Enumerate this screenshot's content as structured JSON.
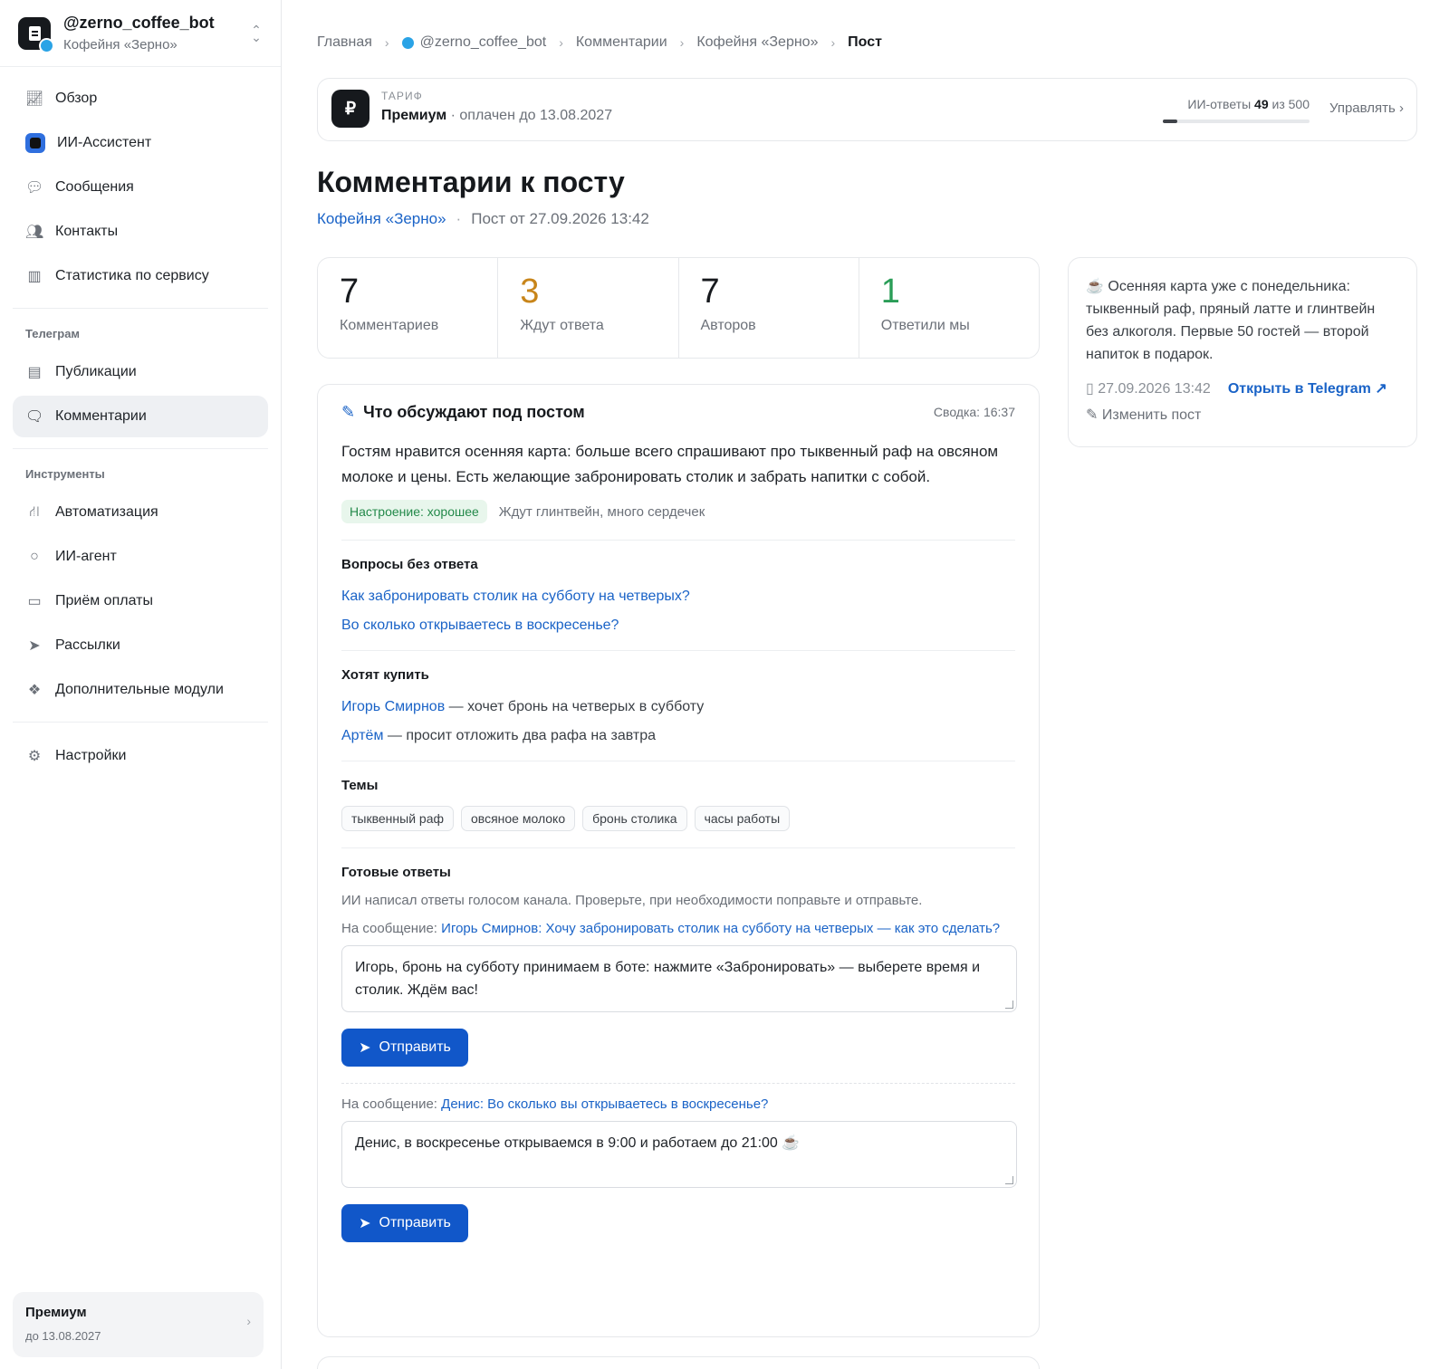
{
  "sidebar": {
    "bot_username": "@zerno_coffee_bot",
    "bot_channel": "Кофейня «Зерно»",
    "items": [
      {
        "label": "Обзор",
        "icon": "chart-line-icon"
      },
      {
        "label": "ИИ-Ассистент",
        "icon": "ai-assistant-icon"
      },
      {
        "label": "Сообщения",
        "icon": "chat-bubbles-icon"
      },
      {
        "label": "Контакты",
        "icon": "users-icon"
      },
      {
        "label": "Статистика по сервису",
        "icon": "bar-chart-icon"
      }
    ],
    "group_telegram": "Телеграм",
    "telegram_items": [
      {
        "label": "Публикации",
        "icon": "newspaper-icon"
      },
      {
        "label": "Комментарии",
        "icon": "comments-icon",
        "active": true
      }
    ],
    "group_tools": "Инструменты",
    "tools_items": [
      {
        "label": "Автоматизация",
        "icon": "flow-icon"
      },
      {
        "label": "ИИ-агент",
        "icon": "circle-icon"
      },
      {
        "label": "Приём оплаты",
        "icon": "card-icon"
      },
      {
        "label": "Рассылки",
        "icon": "send-icon"
      },
      {
        "label": "Дополнительные модули",
        "icon": "cubes-icon"
      }
    ],
    "settings": {
      "label": "Настройки",
      "icon": "gear-icon"
    },
    "plan": {
      "name": "Премиум",
      "until": "до 13.08.2027"
    }
  },
  "breadcrumb": [
    "Главная",
    "@zerno_coffee_bot",
    "Комментарии",
    "Кофейня «Зерно»",
    "Пост"
  ],
  "tariff": {
    "label": "ТАРИФ",
    "name": "Премиум",
    "paid_until": "· оплачен до 13.08.2027",
    "quota_label": "ИИ-ответы",
    "quota_used": "49",
    "quota_of": "из 500",
    "quota_fraction": 0.098,
    "manage": "Управлять"
  },
  "page": {
    "title": "Комментарии к посту",
    "channel": "Кофейня «Зерно»",
    "post_date": "Пост от 27.09.2026 13:42"
  },
  "stats": [
    {
      "value": "7",
      "label": "Комментариев",
      "color": "#16191d"
    },
    {
      "value": "3",
      "label": "Ждут ответа",
      "color": "#c8851a"
    },
    {
      "value": "7",
      "label": "Авторов",
      "color": "#16191d"
    },
    {
      "value": "1",
      "label": "Ответили мы",
      "color": "#2a9d57"
    }
  ],
  "post": {
    "text": "☕ Осенняя карта уже с понедельника: тыквенный раф, пряный латте и глинтвейн без алкоголя. Первые 50 гостей — второй напиток в подарок.",
    "date": "27.09.2026 13:42",
    "open": "Открыть в Telegram",
    "edit": "Изменить пост"
  },
  "summary": {
    "heading": "Что обсуждают под постом",
    "time": "Сводка: 16:37",
    "text": "Гостям нравится осенняя карта: больше всего спрашивают про тыквенный раф на овсяном молоке и цены. Есть желающие забронировать столик и забрать напитки с собой.",
    "mood": "Настроение: хорошее",
    "mood_note": "Ждут глинтвейн, много сердечек",
    "questions_heading": "Вопросы без ответа",
    "questions": [
      "Как забронировать столик на субботу на четверых?",
      "Во сколько открываетесь в воскресенье?"
    ],
    "buyers_heading": "Хотят купить",
    "buyers": [
      {
        "name": "Игорь Смирнов",
        "text": " — хочет бронь на четверых в субботу"
      },
      {
        "name": "Артём",
        "text": " — просит отложить два рафа на завтра"
      }
    ],
    "topics_heading": "Темы",
    "topics": [
      "тыквенный раф",
      "овсяное молоко",
      "бронь столика",
      "часы работы"
    ],
    "replies_heading": "Готовые ответы",
    "replies_note": "ИИ написал ответы голосом канала. Проверьте, при необходимости поправьте и отправьте.",
    "reply_to_label": "На сообщение:",
    "replies": [
      {
        "to": "Игорь Смирнов: Хочу забронировать столик на субботу на четверых — как это сделать?",
        "text": "Игорь, бронь на субботу принимаем в боте: нажмите «Забронировать» — выберете время и столик. Ждём вас!"
      },
      {
        "to": "Денис: Во сколько вы открываетесь в воскресенье?",
        "text": "Денис, в воскресенье открываемся в 9:00 и работаем до 21:00 ☕"
      }
    ],
    "send_label": "Отправить"
  }
}
